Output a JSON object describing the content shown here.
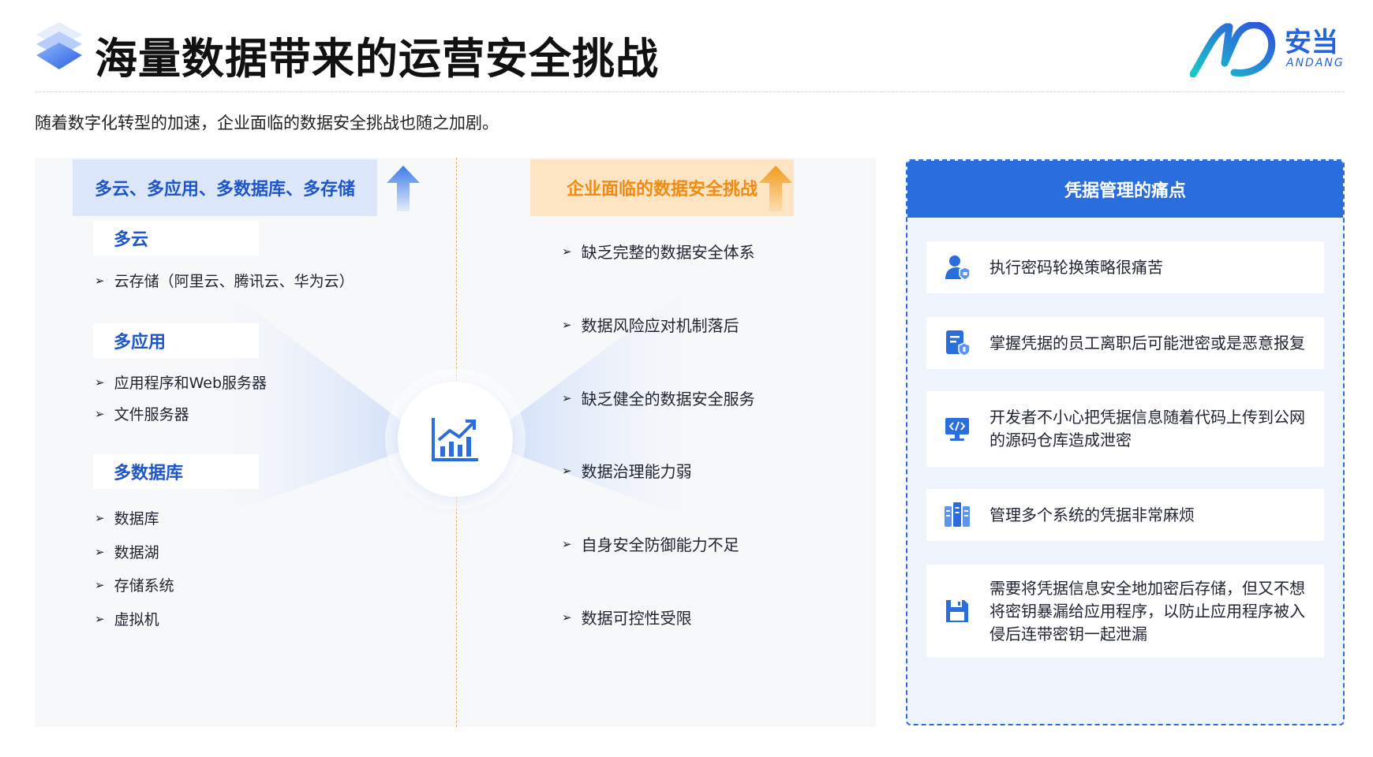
{
  "header": {
    "title": "海量数据带来的运营安全挑战",
    "logo_cn": "安当",
    "logo_en": "ANDANG",
    "subtitle": "随着数字化转型的加速，企业面临的数据安全挑战也随之加剧。"
  },
  "left": {
    "top_label": "多云、多应用、多数据库、多存储",
    "categories": [
      {
        "label": "多云",
        "items": [
          "云存储（阿里云、腾讯云、华为云）"
        ]
      },
      {
        "label": "多应用",
        "items": [
          "应用程序和Web服务器",
          "文件服务器"
        ]
      },
      {
        "label": "多数据库",
        "items": [
          "数据库",
          "数据湖",
          "存储系统",
          "虚拟机"
        ]
      }
    ]
  },
  "middle": {
    "top_label": "企业面临的数据安全挑战",
    "challenges": [
      "缺乏完整的数据安全体系",
      "数据风险应对机制落后",
      "缺乏健全的数据安全服务",
      "数据治理能力弱",
      "自身安全防御能力不足",
      "数据可控性受限"
    ],
    "center_icon": "chart-growth-icon"
  },
  "right": {
    "title": "凭据管理的痛点",
    "cards": [
      {
        "icon": "user-shield-icon",
        "text": "执行密码轮换策略很痛苦"
      },
      {
        "icon": "document-shield-icon",
        "text": "掌握凭据的员工离职后可能泄密或是恶意报复"
      },
      {
        "icon": "code-monitor-icon",
        "lines": [
          "开发者不小心把凭据信息随着代码上传到公网",
          "的源码仓库造成泄密"
        ]
      },
      {
        "icon": "servers-icon",
        "text": "管理多个系统的凭据非常麻烦"
      },
      {
        "icon": "save-disk-icon",
        "lines": [
          "需要将凭据信息安全地加密后存储，但又不想",
          "将密钥暴漏给应用程序，以防止应用程序被入",
          "侵后连带密钥一起泄漏"
        ]
      }
    ]
  },
  "colors": {
    "primary_blue": "#2a6ddc",
    "accent_orange": "#f08a12",
    "label_blue_bg": "#dce7fb",
    "label_orange_bg": "#fde4c2"
  }
}
